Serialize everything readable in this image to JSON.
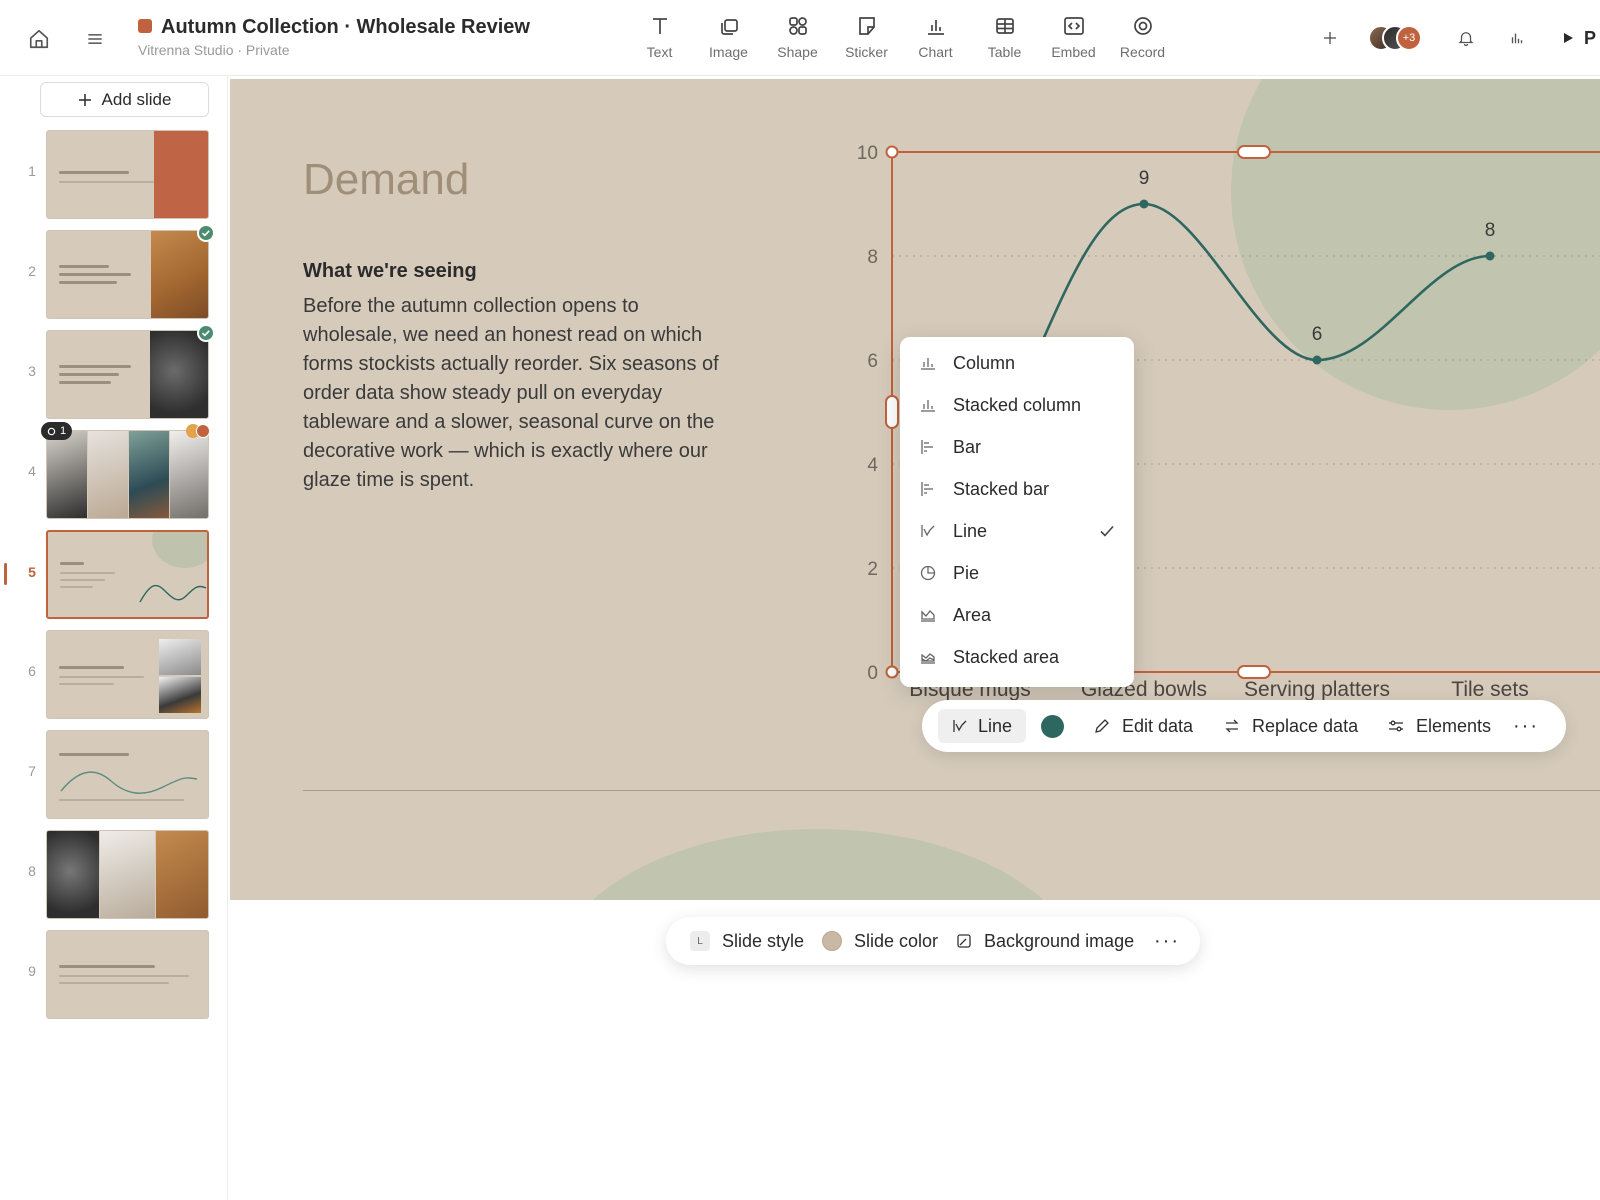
{
  "header": {
    "title": "Autumn Collection · Wholesale Review",
    "subtitle": "Vitrenna Studio · Private",
    "accent_color": "#c0623e",
    "tools": [
      {
        "label": "Text",
        "icon": "text-icon"
      },
      {
        "label": "Image",
        "icon": "image-icon"
      },
      {
        "label": "Shape",
        "icon": "shape-icon"
      },
      {
        "label": "Sticker",
        "icon": "sticker-icon"
      },
      {
        "label": "Chart",
        "icon": "chart-icon"
      },
      {
        "label": "Table",
        "icon": "table-icon"
      },
      {
        "label": "Embed",
        "icon": "embed-icon"
      },
      {
        "label": "Record",
        "icon": "record-icon"
      }
    ],
    "collaborators_extra": "+3",
    "play_label": "P"
  },
  "sidebar": {
    "add_slide_label": "Add slide",
    "slides": [
      {
        "number": "1"
      },
      {
        "number": "2"
      },
      {
        "number": "3"
      },
      {
        "number": "4",
        "comments": "1"
      },
      {
        "number": "5",
        "active": true
      },
      {
        "number": "6"
      },
      {
        "number": "7"
      },
      {
        "number": "8"
      },
      {
        "number": "9"
      }
    ]
  },
  "slide": {
    "title": "Demand",
    "heading": "What we're seeing",
    "body": "Before the autumn collection opens to wholesale, we need an honest read on which forms stockists actually reorder. Six seasons of order data show steady pull on everyday tableware and a slower, seasonal curve on the decorative work — which is exactly where our glaze time is spent.",
    "background_color": "#d6cbbb"
  },
  "chart_data": {
    "type": "line",
    "categories": [
      "Bisque mugs",
      "Glazed bowls",
      "Serving platters",
      "Tile sets"
    ],
    "values": [
      null,
      9,
      6,
      8
    ],
    "data_labels": [
      "",
      "9",
      "6",
      "8"
    ],
    "yticks": [
      "0",
      "2",
      "4",
      "6",
      "8",
      "10"
    ],
    "ylim": [
      0,
      10
    ],
    "line_color": "#2e6760",
    "grid": true
  },
  "chart_type_menu": {
    "items": [
      {
        "label": "Column",
        "icon": "column-chart-icon"
      },
      {
        "label": "Stacked column",
        "icon": "stacked-column-chart-icon"
      },
      {
        "label": "Bar",
        "icon": "bar-chart-icon"
      },
      {
        "label": "Stacked bar",
        "icon": "stacked-bar-chart-icon"
      },
      {
        "label": "Line",
        "icon": "line-chart-icon",
        "selected": true
      },
      {
        "label": "Pie",
        "icon": "pie-chart-icon"
      },
      {
        "label": "Area",
        "icon": "area-chart-icon"
      },
      {
        "label": "Stacked area",
        "icon": "stacked-area-chart-icon"
      }
    ]
  },
  "chart_toolbar": {
    "type_label": "Line",
    "color": "#2e6760",
    "edit_label": "Edit data",
    "replace_label": "Replace data",
    "elements_label": "Elements",
    "more_label": "···"
  },
  "slide_toolbar": {
    "style_label": "Slide style",
    "style_chip": "L",
    "color_label": "Slide color",
    "background_label": "Background image",
    "more_label": "···"
  }
}
